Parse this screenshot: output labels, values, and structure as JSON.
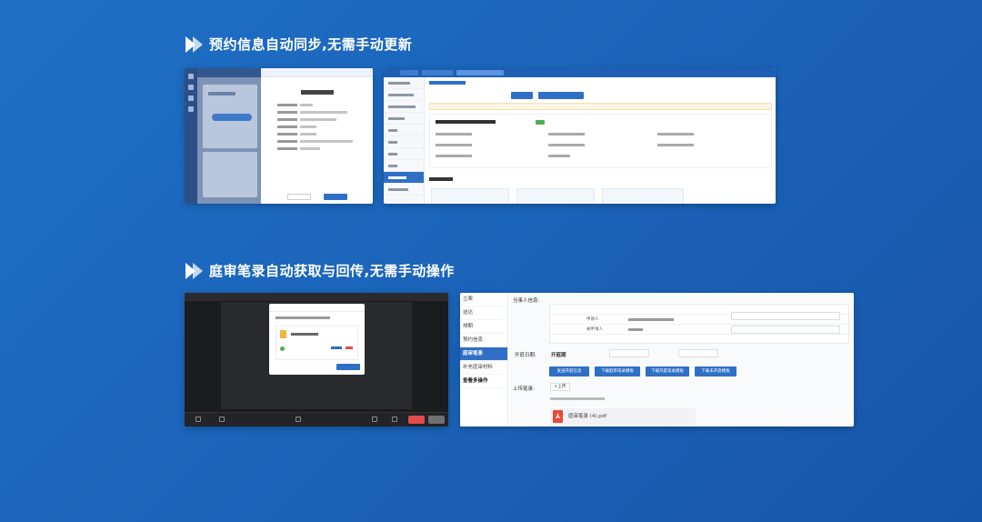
{
  "section1": {
    "title": "预约信息自动同步,无需手动更新"
  },
  "section2": {
    "title": "庭审笔录自动获取与回传,无需手动操作"
  },
  "shot4": {
    "sidebar_items": [
      "立案",
      "送达",
      "排期",
      "预约信息",
      "庭审笔录",
      "补充庭审材料",
      "查看多操作"
    ],
    "active_item": "庭审笔录",
    "labels": {
      "participants": "当事人信息:",
      "hearing_date": "开庭日期:",
      "hearing_date_value": "开庭期",
      "upload": "上传笔录:"
    },
    "upload_button": "+上传",
    "row_labels": [
      "申请人",
      "被申请人"
    ],
    "action_buttons": [
      "发送开庭信息",
      "下载庭审笔录模板",
      "下载开庭笔录模板",
      "下载未开庭模板"
    ],
    "file_name": "庭审笔录 (4).pdf"
  },
  "colors": {
    "background": "#1b63b9",
    "accent": "#2f6fc6",
    "danger": "#e24b4b"
  }
}
